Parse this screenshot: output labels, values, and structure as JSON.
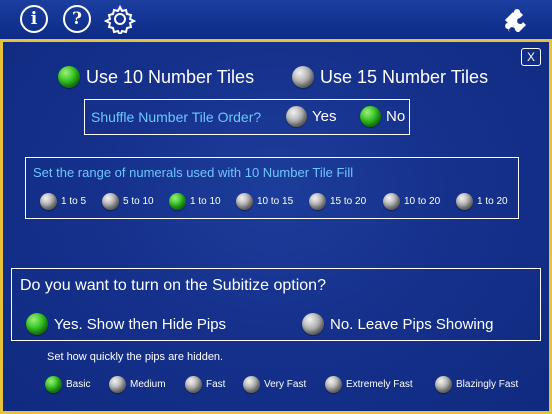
{
  "toolbar": {
    "info_label": "i",
    "help_label": "?"
  },
  "close_label": "X",
  "tile_options": [
    {
      "label": "Use 10 Number Tiles",
      "selected": true
    },
    {
      "label": "Use 15 Number Tiles",
      "selected": false
    }
  ],
  "shuffle": {
    "question": "Shuffle Number Tile Order?",
    "options": [
      {
        "label": "Yes",
        "selected": false
      },
      {
        "label": "No",
        "selected": true
      }
    ]
  },
  "range": {
    "title": "Set the range of numerals used with 10 Number Tile Fill",
    "options": [
      {
        "label": "1 to 5",
        "selected": false
      },
      {
        "label": "5 to 10",
        "selected": false
      },
      {
        "label": "1 to 10",
        "selected": true
      },
      {
        "label": "10 to 15",
        "selected": false
      },
      {
        "label": "15 to 20",
        "selected": false
      },
      {
        "label": "10 to 20",
        "selected": false
      },
      {
        "label": "1 to 20",
        "selected": false
      }
    ]
  },
  "subitize": {
    "question": "Do you want to turn on the Subitize option?",
    "options": [
      {
        "label": "Yes. Show then Hide Pips",
        "selected": true
      },
      {
        "label": "No. Leave Pips Showing",
        "selected": false
      }
    ]
  },
  "speed": {
    "title": "Set how quickly the pips are hidden.",
    "options": [
      {
        "label": "Basic",
        "selected": true
      },
      {
        "label": "Medium",
        "selected": false
      },
      {
        "label": "Fast",
        "selected": false
      },
      {
        "label": "Very Fast",
        "selected": false
      },
      {
        "label": "Extremely Fast",
        "selected": false
      },
      {
        "label": "Blazingly Fast",
        "selected": false
      }
    ]
  },
  "colors": {
    "accent_border": "#e8c33a",
    "selected": "#2fbf1f",
    "unselected": "#a8a8a8",
    "question_text": "#6ec6ff"
  }
}
